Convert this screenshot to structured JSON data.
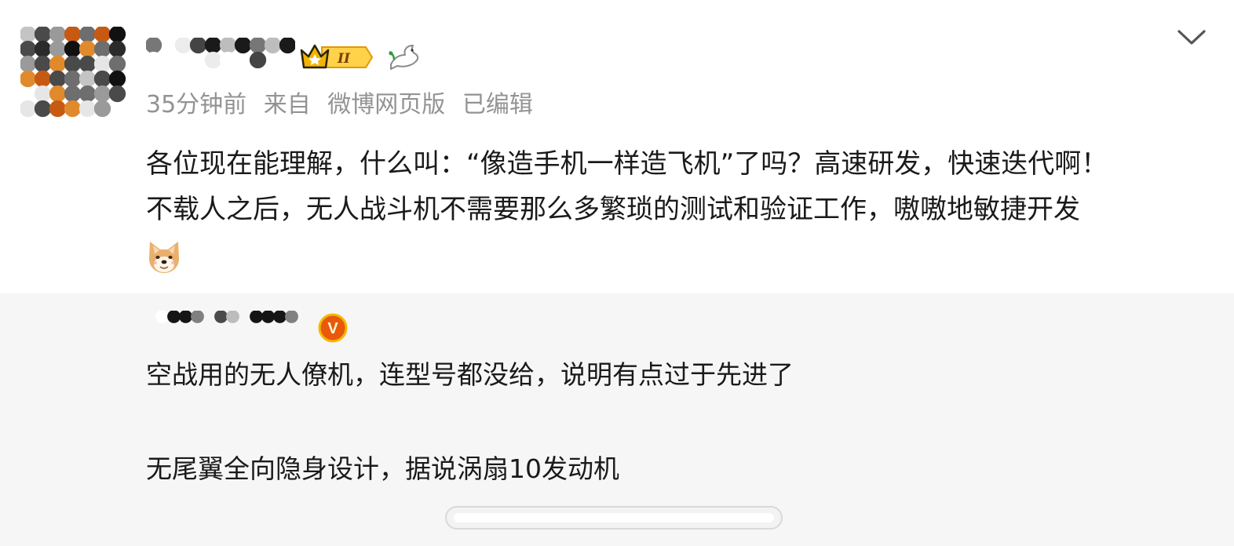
{
  "post": {
    "author_name": "",
    "meta": {
      "time": "35分钟前",
      "source_prefix": "来自",
      "source": "微博网页版",
      "edited": "已编辑"
    },
    "text_lines": [
      "各位现在能理解，什么叫：“像造手机一样造飞机”了吗？高速研发，快速迭代啊！",
      "不载人之后，无人战斗机不需要那么多繁琐的测试和验证工作，嗷嗷地敏捷开发"
    ],
    "badge_level": "II",
    "icons": {
      "menu": "chevron-down-icon",
      "member": "crown-icon",
      "dove": "dove-icon",
      "emoji": "doge-emoji"
    }
  },
  "repost": {
    "author_name": "",
    "verified_badge": "V",
    "text_lines": [
      "空战用的无人僚机，连型号都没给，说明有点过于先进了",
      "无尾翼全向隐身设计，据说涡扇10发动机"
    ],
    "icons": {
      "verified": "verified-v-icon"
    }
  },
  "colors": {
    "meta_text": "#939393",
    "body_text": "#1a1a1a",
    "quote_bg": "#f6f6f6",
    "badge_gold": "#f5b800",
    "verified_orange": "#e8590c"
  }
}
